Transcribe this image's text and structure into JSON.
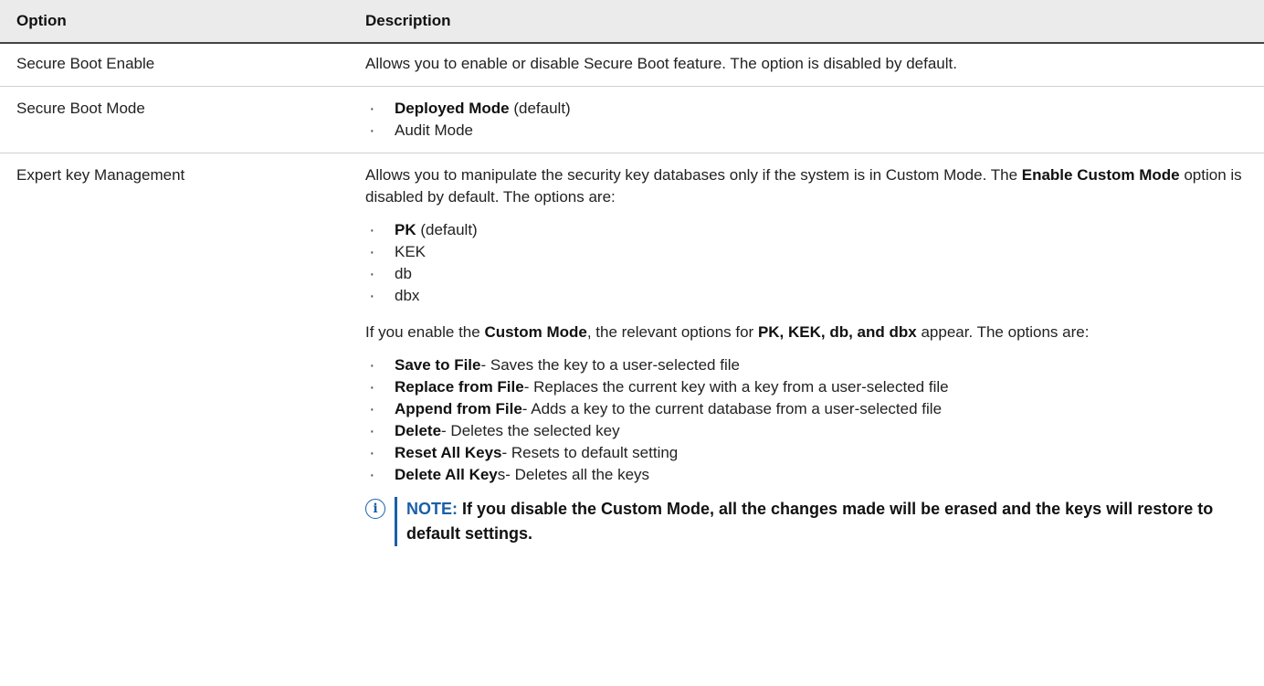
{
  "header": {
    "col_option": "Option",
    "col_description": "Description"
  },
  "rows": [
    {
      "option": "Secure Boot Enable",
      "desc": "Allows you to enable or disable Secure Boot feature. The option is disabled by default."
    },
    {
      "option": "Secure Boot Mode",
      "items": [
        {
          "bold": "Deployed Mode",
          "rest": " (default)"
        },
        {
          "bold": "",
          "rest": "Audit Mode"
        }
      ]
    },
    {
      "option": "Expert key Management",
      "intro": {
        "a": "Allows you to manipulate the security key databases only if the system is in Custom Mode. The ",
        "b": "Enable Custom Mode",
        "c": " option is disabled by default. The options are:"
      },
      "keys": [
        {
          "bold": "PK",
          "rest": " (default)"
        },
        {
          "bold": "",
          "rest": "KEK"
        },
        {
          "bold": "",
          "rest": "db"
        },
        {
          "bold": "",
          "rest": "dbx"
        }
      ],
      "custom": {
        "a": "If you enable the ",
        "b": "Custom Mode",
        "c": ", the relevant options for ",
        "d": "PK, KEK, db, and dbx",
        "e": " appear. The options are:"
      },
      "actions": [
        {
          "bold": "Save to File",
          "rest": "- Saves the key to a user-selected file"
        },
        {
          "bold": "Replace from File",
          "rest": "- Replaces the current key with a key from a user-selected file"
        },
        {
          "bold": "Append from File",
          "rest": "- Adds a key to the current database from a user-selected file"
        },
        {
          "bold": "Delete",
          "rest": "- Deletes the selected key"
        },
        {
          "bold": "Reset All Keys",
          "rest": "- Resets to default setting"
        },
        {
          "bold": "Delete All Key",
          "rest": "s- Deletes all the keys"
        }
      ],
      "note": {
        "label": "NOTE:",
        "text": " If you disable the Custom Mode, all the changes made will be erased and the keys will restore to default settings."
      }
    }
  ],
  "icons": {
    "note": "info-icon"
  },
  "colors": {
    "accent": "#1a5fa8",
    "header_bg": "#ebebeb"
  }
}
